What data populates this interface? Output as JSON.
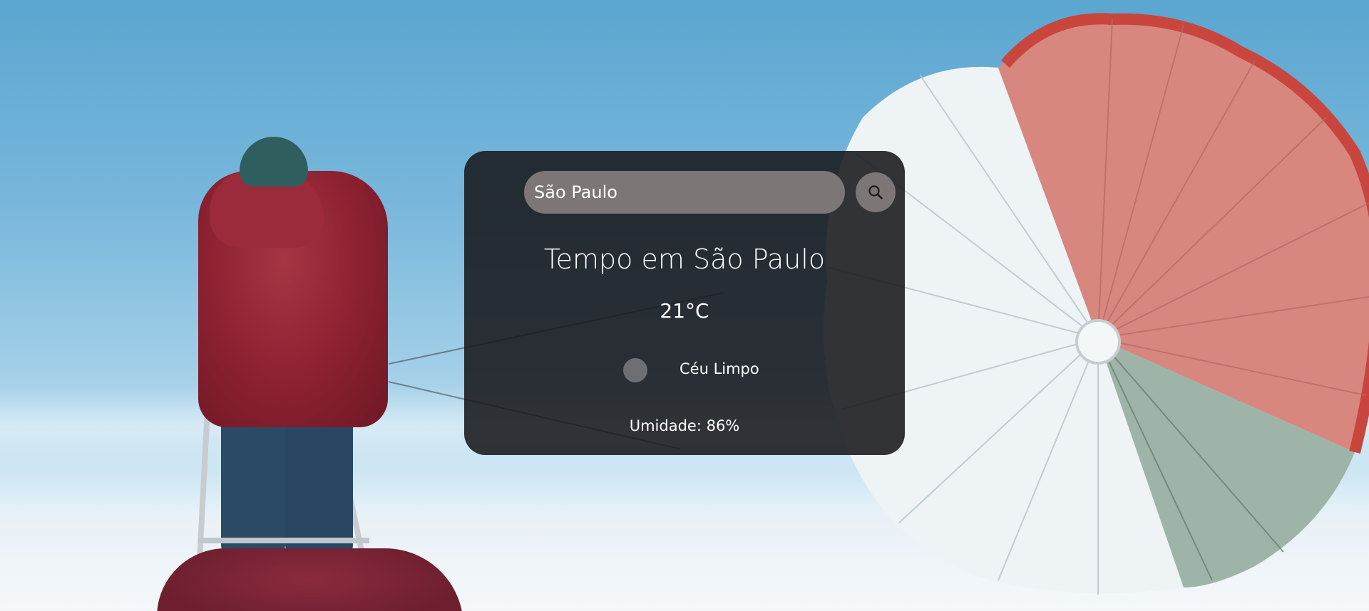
{
  "search": {
    "value": "São Paulo",
    "button_icon": "search-icon"
  },
  "weather": {
    "title": "Tempo em São Paulo",
    "temperature": "21°C",
    "description": "Céu Limpo",
    "description_icon": "weather-condition-icon",
    "humidity": "Umidade: 86%"
  },
  "colors": {
    "card_background": "#18181b",
    "input_background": "#7c7677",
    "text": "#ffffff"
  }
}
